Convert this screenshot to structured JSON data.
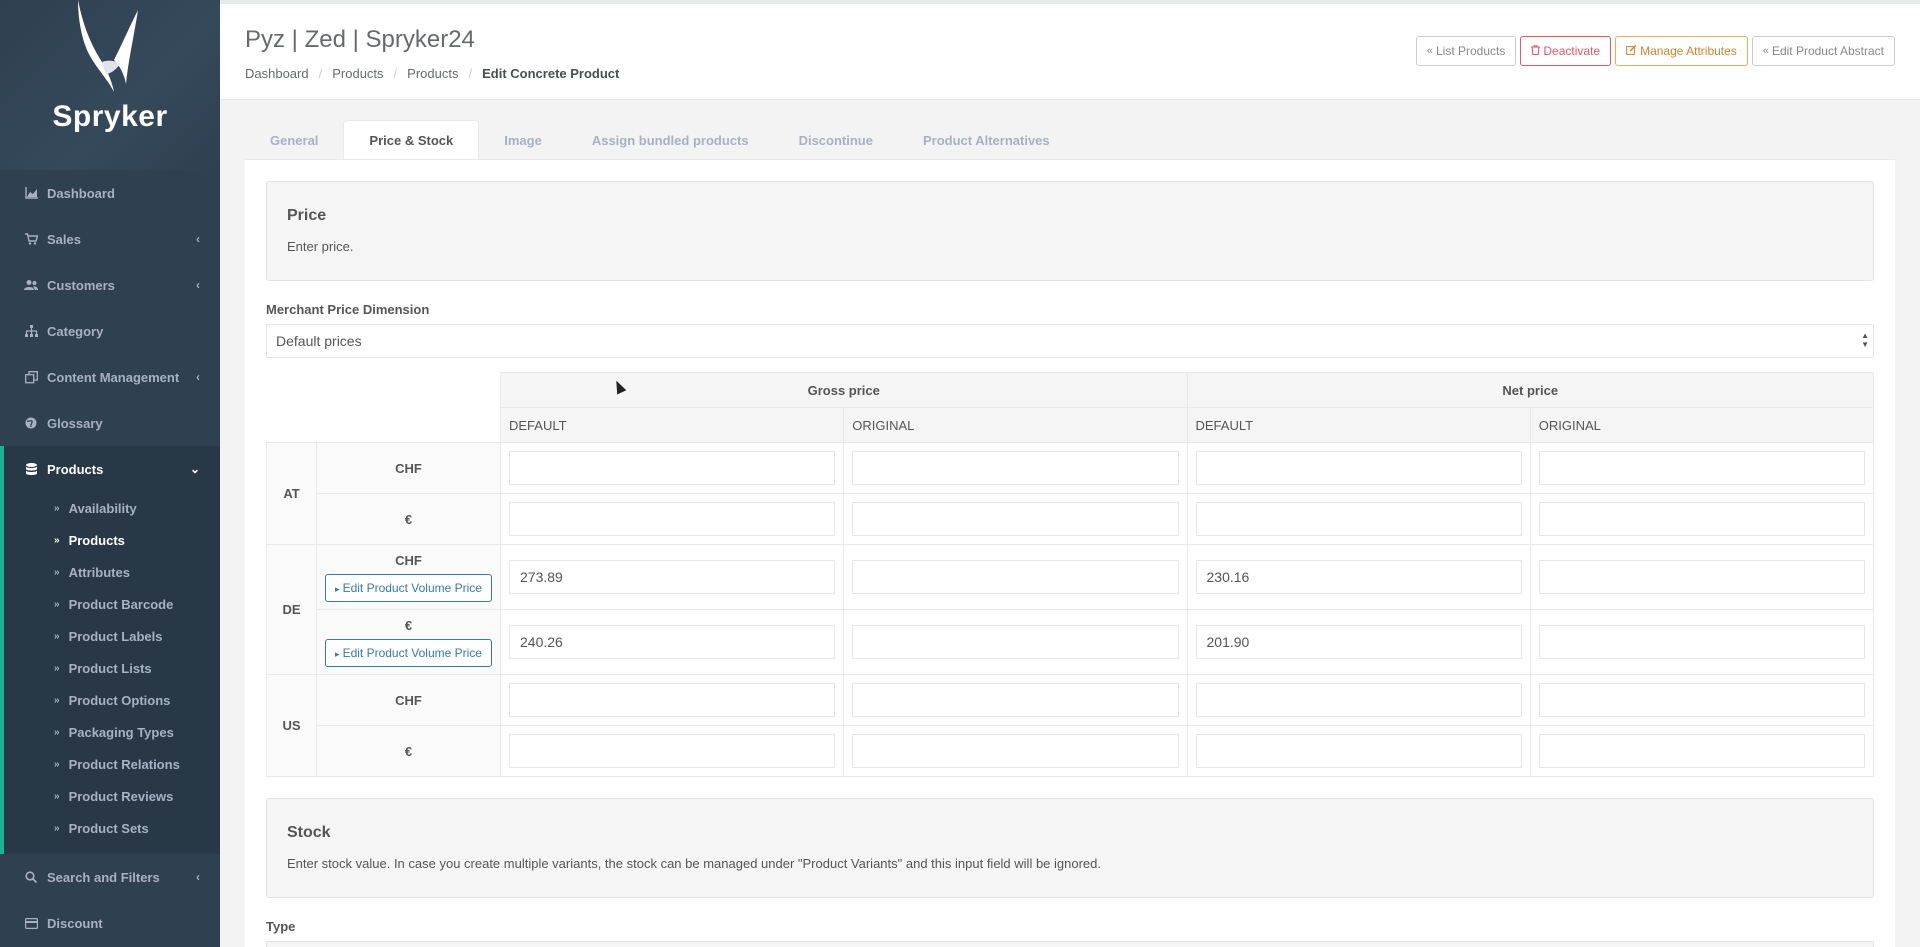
{
  "brand": {
    "name": "Spryker",
    "accent": "#1ab394",
    "sidebar_bg": "#2f4050"
  },
  "sidebar": {
    "items": [
      {
        "label": "Dashboard",
        "icon": "chart-area-icon"
      },
      {
        "label": "Sales",
        "icon": "cart-icon"
      },
      {
        "label": "Customers",
        "icon": "users-icon"
      },
      {
        "label": "Category",
        "icon": "sitemap-icon"
      },
      {
        "label": "Content Management",
        "icon": "clone-icon"
      },
      {
        "label": "Glossary",
        "icon": "globe-icon"
      },
      {
        "label": "Products",
        "icon": "database-icon"
      },
      {
        "label": "Search and Filters",
        "icon": "search-icon"
      },
      {
        "label": "Discount",
        "icon": "credit-card-icon"
      }
    ],
    "products_sub": [
      "Availability",
      "Products",
      "Attributes",
      "Product Barcode",
      "Product Labels",
      "Product Lists",
      "Product Options",
      "Packaging Types",
      "Product Relations",
      "Product Reviews",
      "Product Sets"
    ]
  },
  "header": {
    "title": "Pyz | Zed | Spryker24",
    "breadcrumb": [
      "Dashboard",
      "Products",
      "Products",
      "Edit Concrete Product"
    ],
    "buttons": {
      "list_products": "List Products",
      "deactivate": "Deactivate",
      "manage_attributes": "Manage Attributes",
      "edit_abstract": "Edit Product Abstract"
    }
  },
  "tabs": [
    "General",
    "Price & Stock",
    "Image",
    "Assign bundled products",
    "Discontinue",
    "Product Alternatives"
  ],
  "price": {
    "title": "Price",
    "description": "Enter price.",
    "dimension_label": "Merchant Price Dimension",
    "dimension_value": "Default prices",
    "gross_header": "Gross price",
    "net_header": "Net price",
    "col_default": "DEFAULT",
    "col_original": "ORIGINAL",
    "volume_btn": "Edit Product Volume Price",
    "rows": {
      "at": {
        "country": "AT",
        "cur1": "CHF",
        "cur2": "€"
      },
      "de": {
        "country": "DE",
        "cur1": "CHF",
        "cur2": "€",
        "chf_gross_default": "273.89",
        "chf_net_default": "230.16",
        "eur_gross_default": "240.26",
        "eur_net_default": "201.90"
      },
      "us": {
        "country": "US",
        "cur1": "CHF",
        "cur2": "€"
      }
    }
  },
  "stock": {
    "title": "Stock",
    "description": "Enter stock value. In case you create multiple variants, the stock can be managed under \"Product Variants\" and this input field will be ignored.",
    "type_label": "Type"
  }
}
